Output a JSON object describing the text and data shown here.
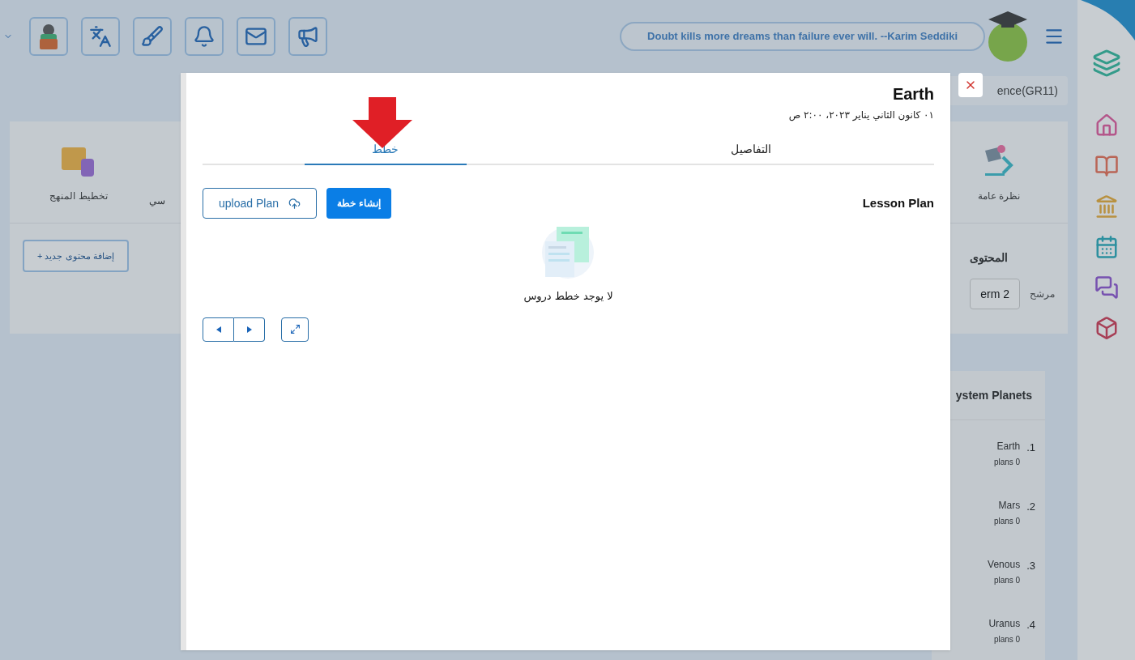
{
  "header": {
    "quote": "Doubt kills more dreams than failure ever will. --Karim Seddiki"
  },
  "background": {
    "course": "ence(GR11)",
    "overview": [
      {
        "label": "نظرة عامة",
        "kind": "overview"
      },
      {
        "label": "سي",
        "kind": "cut"
      },
      {
        "label": "تخطيط المنهج",
        "kind": "curriculum"
      }
    ],
    "content_title": "المحتوى",
    "filter_label": "مرشح",
    "filter_value": "erm 2",
    "add_button": "+ إضافة محتوى جديد",
    "planets_title": "ystem Planets",
    "planets": [
      {
        "number": "1.",
        "name": "Earth",
        "plans": "plans 0"
      },
      {
        "number": "2.",
        "name": "Mars",
        "plans": "plans 0"
      },
      {
        "number": "3.",
        "name": "Venous",
        "plans": "plans 0"
      },
      {
        "number": "4.",
        "name": "Uranus",
        "plans": "plans 0"
      }
    ]
  },
  "modal": {
    "title": "Earth",
    "date": "٠١ كانون الثاني يناير ٢٠٢٣، ٢:٠٠ ص",
    "tabs": [
      {
        "label": "التفاصيل",
        "selected": false
      },
      {
        "label": "خطط",
        "selected": true
      }
    ],
    "section_title": "Lesson Plan",
    "upload_button": "upload Plan",
    "create_button": "إنشاء خطة",
    "empty_text": "لا يوجد خطط دروس"
  }
}
